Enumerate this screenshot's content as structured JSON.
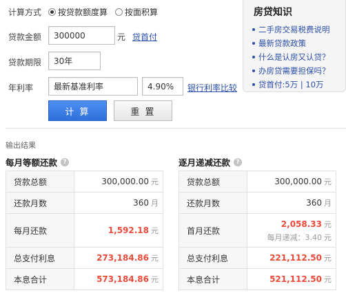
{
  "form": {
    "calc_method_label": "计算方式",
    "radio_loan_amount": "按贷款额度算",
    "radio_area": "按面积算",
    "loan_amount_label": "贷款金额",
    "loan_amount_value": "300000",
    "loan_amount_unit": "元",
    "down_payment_link": "贷首付",
    "period_label": "贷款期限",
    "period_value": "30年",
    "rate_label": "年利率",
    "rate_type_value": "最新基准利率",
    "rate_value": "4.90%",
    "rate_compare_link": "银行利率比较",
    "calc_button": "计 算",
    "reset_button": "重 置"
  },
  "knowledge": {
    "title": "房贷知识",
    "items": [
      "二手房交易税费说明",
      "最新贷款政策",
      "什么是认房又认贷？",
      "办房贷需要担保吗？",
      "贷首付:5万 | 10万"
    ]
  },
  "results": {
    "section_label": "输出结果",
    "equal_payment": {
      "title": "每月等额还款",
      "rows": [
        {
          "label": "贷款总额",
          "value": "300,000.00",
          "unit": "元"
        },
        {
          "label": "还款月数",
          "value": "360",
          "unit": "月"
        },
        {
          "label": "每月还款",
          "value": "1,592.18",
          "unit": "元"
        },
        {
          "label": "总支付利息",
          "value": "273,184.86",
          "unit": "元"
        },
        {
          "label": "本息合计",
          "value": "573,184.86",
          "unit": "元"
        }
      ]
    },
    "decreasing_payment": {
      "title": "逐月递减还款",
      "rows": [
        {
          "label": "贷款总额",
          "value": "300,000.00",
          "unit": "元"
        },
        {
          "label": "还款月数",
          "value": "360",
          "unit": "月"
        },
        {
          "label": "首月还款",
          "value": "2,058.33",
          "unit": "元",
          "sub_label": "每月递减：",
          "sub_value": "3.40",
          "sub_unit": "元"
        },
        {
          "label": "总支付利息",
          "value": "221,112.50",
          "unit": "元"
        },
        {
          "label": "本息合计",
          "value": "521,112.50",
          "unit": "元"
        }
      ]
    }
  },
  "colors": {
    "accent_blue": "#2f6fdc",
    "highlight_red": "#e84a3a",
    "link_blue": "#2c4fa8"
  }
}
